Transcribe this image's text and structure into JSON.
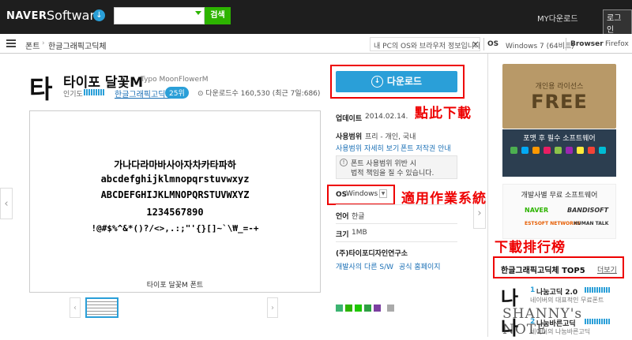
{
  "topbar": {
    "logo_naver": "NAVER",
    "logo_software": "Software",
    "search_placeholder": "",
    "search_button": "검색",
    "my_download": "MY다운로드",
    "login": "로그인"
  },
  "subbar": {
    "breadcrumb": [
      "폰트",
      "한글그래픽고딕체"
    ],
    "os_notice": "내 PC의 OS와 브라우저 정보입니다.",
    "os_label": "OS",
    "os_value": "Windows 7 (64비트)",
    "browser_label": "Browser",
    "browser_value": "Firefox"
  },
  "font": {
    "glyph": "타",
    "title": "타이포 달꽃M",
    "title_en": "Typo MoonFlowerM",
    "popularity_label": "인기도",
    "category": "한글그래픽고딕체",
    "rank": "25위",
    "download_count": "다운로드수 160,530 (최근 7일:686)"
  },
  "preview": {
    "lines": [
      "가나다라마바사아자차카타파하",
      "abcdefghijklmnopqrstuvwxyz",
      "ABCDEFGHIJKLMNOPQRSTUVWXYZ",
      "1234567890",
      "!@#$%^&*()?/<>,.:;\"'{}[]~`\\₩_=-+"
    ],
    "caption": "타이포 달꽃M 폰트"
  },
  "download": {
    "button_label": "다운로드",
    "annotation": "點此下載"
  },
  "details": {
    "update_label": "업데이트",
    "update_value": "2014.02.14.",
    "usage_label": "사용범위",
    "usage_value": "프리 - 개인, 국내",
    "usage_more_link": "사용범위 자세히 보기",
    "copyright_link": "폰트 저작권 안내",
    "warning_line1": "폰트 사용범위 위반 시",
    "warning_line2": "법적 책임을 질 수 있습니다.",
    "os_label": "OS",
    "os_value": "Windows",
    "os_annotation": "適用作業系統",
    "lang_label": "언어",
    "lang_value": "한글",
    "size_label": "크기",
    "size_value": "1MB",
    "publisher": "(주)타이포디자인연구소",
    "publisher_link1": "개발사의 다른 S/W",
    "publisher_link2": "공식 홈페이지"
  },
  "sidebar": {
    "ad1_sub": "개인용 라이선스",
    "ad1_main": "FREE",
    "ad2_title": "포맷 후 필수 소프트웨어",
    "ad3_title": "개발사별 무료 소프트웨어",
    "ad3_logos": [
      "NAVER",
      "BANDISOFT",
      "ESTSOFT NETWORKS",
      "HUMAN TALK"
    ],
    "ranking_annotation": "下載排行榜",
    "top5_title": "한글그래픽고딕체 TOP5",
    "top5_more": "더보기",
    "rankings": [
      {
        "glyph": "나",
        "num": "1",
        "name": "나눔고딕 2.0",
        "desc": "네이버의 대표적인 무료폰트"
      },
      {
        "glyph": "나",
        "num": "2",
        "name": "나눔바른고딕",
        "desc": "네이버의 나눔바른고딕"
      }
    ],
    "watermark": "SHANNY's NOTE"
  },
  "colors": {
    "accent": "#2a9fd8",
    "naver_green": "#2db400",
    "annotation_red": "#e00000"
  }
}
